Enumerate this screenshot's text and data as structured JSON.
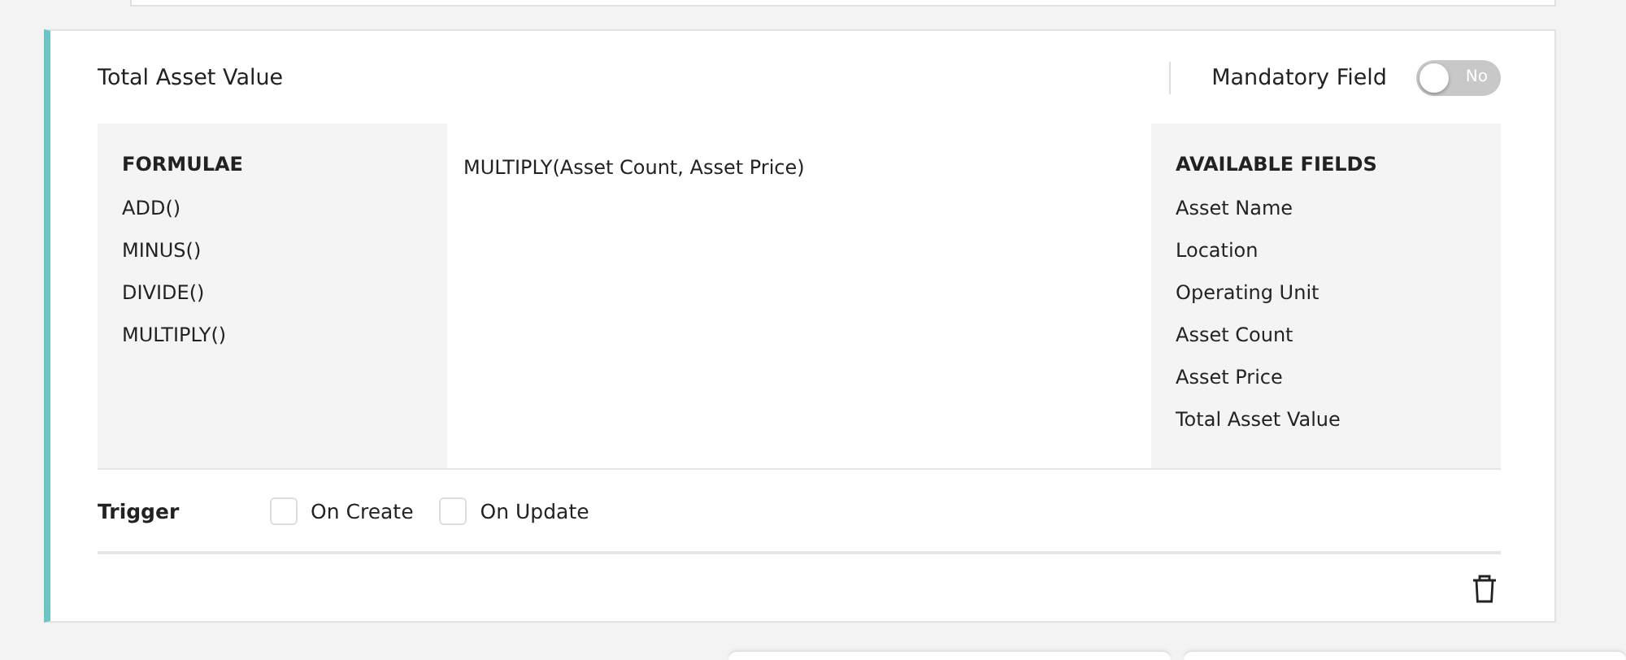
{
  "field": {
    "title": "Total Asset Value",
    "mandatory": {
      "label": "Mandatory Field",
      "on": false,
      "state_text": "No"
    }
  },
  "formulae": {
    "heading": "FORMULAE",
    "items": [
      "ADD()",
      "MINUS()",
      "DIVIDE()",
      "MULTIPLY()"
    ]
  },
  "expression": {
    "value": "MULTIPLY(Asset Count, Asset Price)"
  },
  "available_fields": {
    "heading": "AVAILABLE FIELDS",
    "items": [
      "Asset Name",
      "Location",
      "Operating Unit",
      "Asset Count",
      "Asset Price",
      "Total Asset Value"
    ]
  },
  "trigger": {
    "label": "Trigger",
    "options": [
      {
        "label": "On Create",
        "checked": false
      },
      {
        "label": "On Update",
        "checked": false
      }
    ]
  }
}
